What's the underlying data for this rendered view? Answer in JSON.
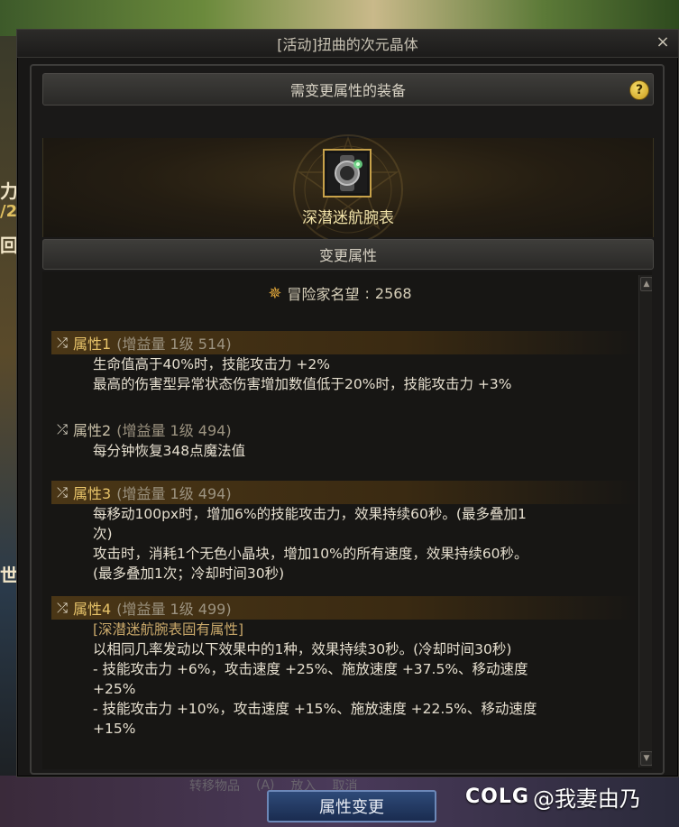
{
  "window": {
    "title": "[活动]扭曲的次元晶体",
    "close_glyph": "×"
  },
  "background": {
    "left_texts": [
      "力",
      "/2",
      "回",
      "世界"
    ],
    "bottom_tabs": [
      "转移物品",
      "",
      "(A)",
      "放入",
      "取消"
    ]
  },
  "equip_section": {
    "header": "需变更属性的装备",
    "help_glyph": "?",
    "item_name": "深潜迷航腕表",
    "item_icon": "wristwatch-icon"
  },
  "change_section": {
    "header": "变更属性",
    "fame_label": "冒险家名望",
    "fame_separator": ":",
    "fame_value": "2568",
    "fame_icon": "fame-crest-icon"
  },
  "attributes": [
    {
      "name": "属性1",
      "meta": "(增益量 1级 514)",
      "highlight": true,
      "lines": [
        "生命值高于40%时，技能攻击力 +2%",
        "最高的伤害型异常状态伤害增加数值低于20%时，技能攻击力 +3%"
      ]
    },
    {
      "name": "属性2",
      "meta": "(增益量 1级 494)",
      "highlight": false,
      "lines": [
        "每分钟恢复348点魔法值"
      ]
    },
    {
      "name": "属性3",
      "meta": "(增益量 1级 494)",
      "highlight": true,
      "lines": [
        "每移动100px时，增加6%的技能攻击力，效果持续60秒。(最多叠加1",
        "次)",
        "攻击时，消耗1个无色小晶块，增加10%的所有速度，效果持续60秒。",
        "(最多叠加1次；冷却时间30秒)"
      ]
    },
    {
      "name": "属性4",
      "meta": "(增益量 1级 499)",
      "highlight": true,
      "note": "[深潜迷航腕表固有属性]",
      "lines": [
        "以相同几率发动以下效果中的1种，效果持续30秒。(冷却时间30秒)",
        "- 技能攻击力 +6%，攻击速度 +25%、施放速度 +37.5%、移动速度",
        "+25%",
        "- 技能攻击力 +10%，攻击速度 +15%、施放速度 +22.5%、移动速度",
        "+15%"
      ]
    }
  ],
  "action_button": "属性变更",
  "watermark": {
    "logo": "COLG",
    "text": "@我妻由乃"
  },
  "colors": {
    "attr_name": "#e8c46a",
    "item_border": "#c8a24a",
    "button_border": "#6c88b8"
  }
}
